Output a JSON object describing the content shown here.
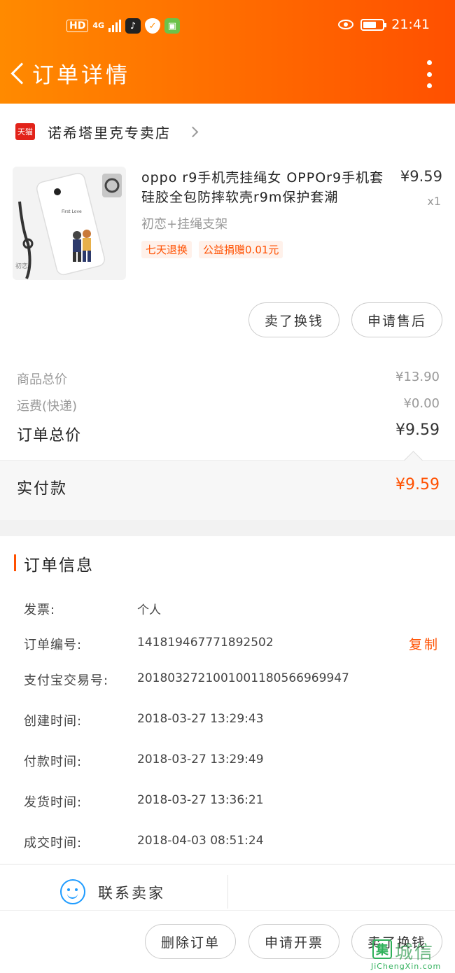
{
  "status_bar": {
    "hd": "HD",
    "network": "4G",
    "time": "21:41"
  },
  "header": {
    "title": "订单详情"
  },
  "shop": {
    "badge": "天猫",
    "name": "诺希塔里克专卖店"
  },
  "item": {
    "title": "oppo r9手机壳挂绳女 OPPOr9手机套硅胶全包防摔软壳r9m保护套潮",
    "price": "¥9.59",
    "qty": "x1",
    "sku": "初恋+挂绳支架",
    "thumb_label": "初恋",
    "tags": [
      "七天退换",
      "公益捐赠0.01元"
    ]
  },
  "actions": {
    "sell": "卖了换钱",
    "after_sale": "申请售后"
  },
  "summary": {
    "goods_label": "商品总价",
    "goods_value": "¥13.90",
    "shipping_label": "运费(快递)",
    "shipping_value": "¥0.00",
    "total_label": "订单总价",
    "total_value": "¥9.59",
    "paid_label": "实付款",
    "paid_value": "¥9.59"
  },
  "order_info": {
    "title": "订单信息",
    "rows": [
      {
        "label": "发票:",
        "value": "个人"
      },
      {
        "label": "订单编号:",
        "value": "141819467771892502"
      },
      {
        "label": "支付宝交易号:",
        "value": "2018032721001001180566969947"
      },
      {
        "label": "创建时间:",
        "value": "2018-03-27 13:29:43"
      },
      {
        "label": "付款时间:",
        "value": "2018-03-27 13:29:49"
      },
      {
        "label": "发货时间:",
        "value": "2018-03-27 13:36:21"
      },
      {
        "label": "成交时间:",
        "value": "2018-04-03 08:51:24"
      }
    ],
    "copy": "复制"
  },
  "contact": {
    "label": "联系卖家"
  },
  "bottom": {
    "delete": "删除订单",
    "invoice": "申请开票",
    "sell": "卖了换钱"
  },
  "watermark": {
    "mark": "集",
    "text": "城信",
    "url": "JiChengXin.com"
  },
  "colors": {
    "brand": "#ff5000",
    "header_start": "#ff8a00",
    "tmall": "#e2231a",
    "contact": "#1e9bff"
  }
}
